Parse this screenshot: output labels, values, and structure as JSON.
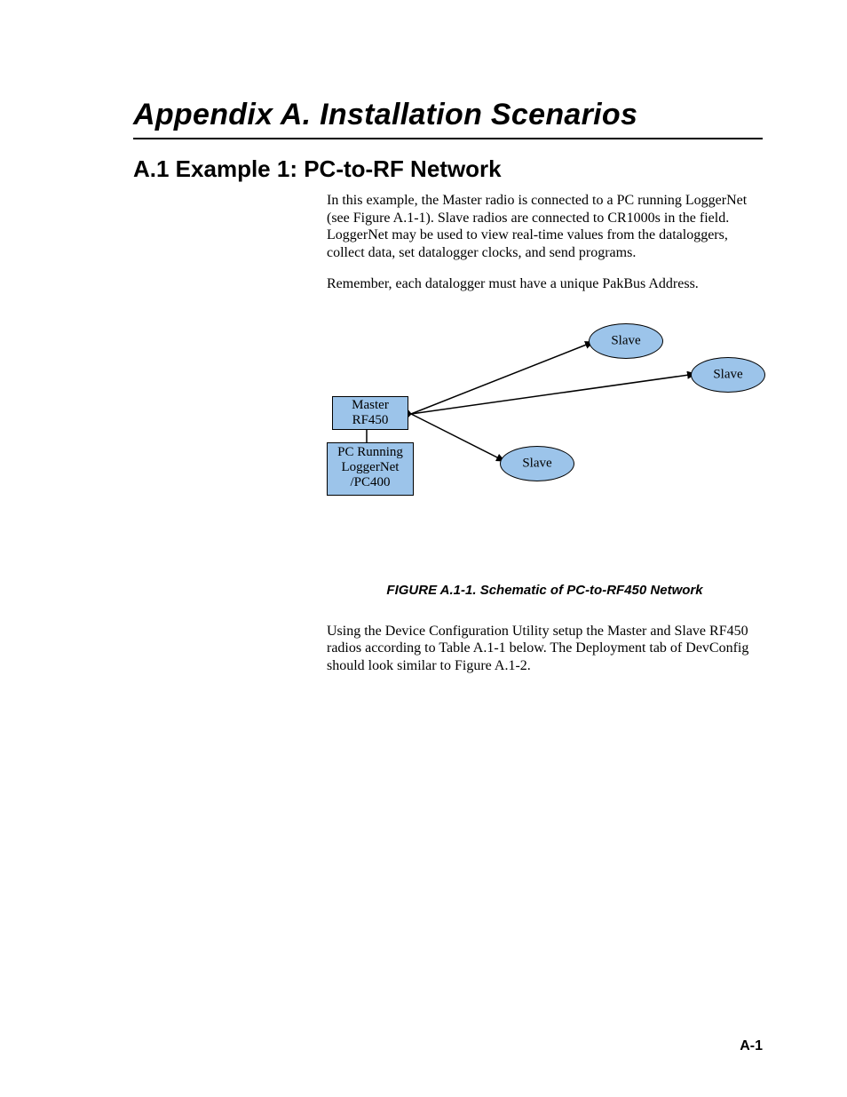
{
  "heading": {
    "appendix_title": "Appendix A.  Installation Scenarios",
    "section_title": "A.1  Example 1:  PC-to-RF Network"
  },
  "paragraphs": {
    "p1": "In this example, the Master radio is connected to a PC running LoggerNet (see Figure A.1-1).  Slave radios are connected to CR1000s in the field.  LoggerNet may be used to view real-time values from the dataloggers, collect data, set datalogger clocks, and send programs.",
    "p2": "Remember, each datalogger must have a unique PakBus Address.",
    "p3": "Using the Device Configuration Utility setup the Master and Slave RF450 radios according to Table A.1-1 below.  The Deployment tab of DevConfig should look similar to Figure A.1-2."
  },
  "figure": {
    "caption": "FIGURE A.1-1.  Schematic of PC-to-RF450 Network",
    "nodes": {
      "master_line1": "Master",
      "master_line2": "RF450",
      "pc_line1": "PC Running",
      "pc_line2": "LoggerNet",
      "pc_line3": "/PC400",
      "slave1": "Slave",
      "slave2": "Slave",
      "slave3": "Slave"
    }
  },
  "page_number": "A-1"
}
